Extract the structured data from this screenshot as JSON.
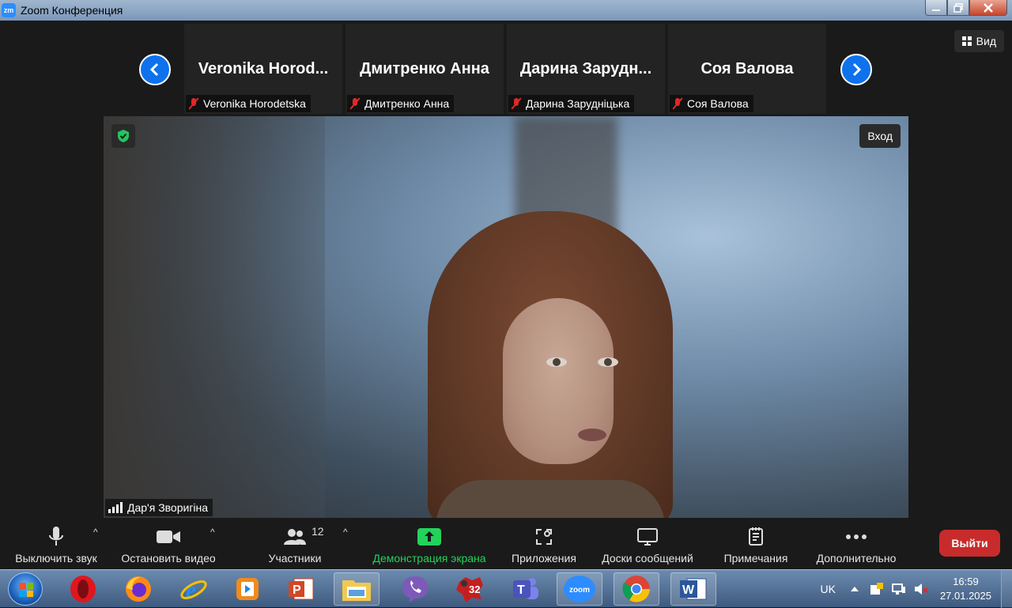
{
  "window": {
    "title": "Zoom Конференция",
    "logo": "zm"
  },
  "view_button": {
    "label": "Вид"
  },
  "participants_strip": [
    {
      "display_name": "Veronika  Horod...",
      "tag_name": "Veronika Horodetska"
    },
    {
      "display_name": "Дмитренко Анна",
      "tag_name": "Дмитренко Анна"
    },
    {
      "display_name": "Дарина  Зарудн...",
      "tag_name": "Дарина Заруднiцька"
    },
    {
      "display_name": "Соя Валова",
      "tag_name": "Соя Валова"
    }
  ],
  "main_video": {
    "speaker_name": "Дар'я Зворигіна",
    "enter_label": "Вход"
  },
  "toolbar": {
    "mute_label": "Выключить звук",
    "video_label": "Остановить видео",
    "participants_label": "Участники",
    "participants_count": "12",
    "share_label": "Демонстрация экрана",
    "apps_label": "Приложения",
    "whiteboards_label": "Доски сообщений",
    "notes_label": "Примечания",
    "more_label": "Дополнительно",
    "leave_label": "Выйти"
  },
  "taskbar": {
    "language": "UK",
    "time": "16:59",
    "date": "27.01.2025",
    "opera_badge": "32",
    "zoom_label": "zoom",
    "apps": [
      "start",
      "opera",
      "firefox",
      "internet-explorer",
      "media-player",
      "powerpoint",
      "file-explorer",
      "viber",
      "game-32",
      "teams",
      "zoom",
      "chrome",
      "word"
    ]
  },
  "colors": {
    "accent_blue": "#0e72ed",
    "share_green": "#22d35a",
    "leave_red": "#c82b2b",
    "mic_off_red": "#e02828"
  }
}
